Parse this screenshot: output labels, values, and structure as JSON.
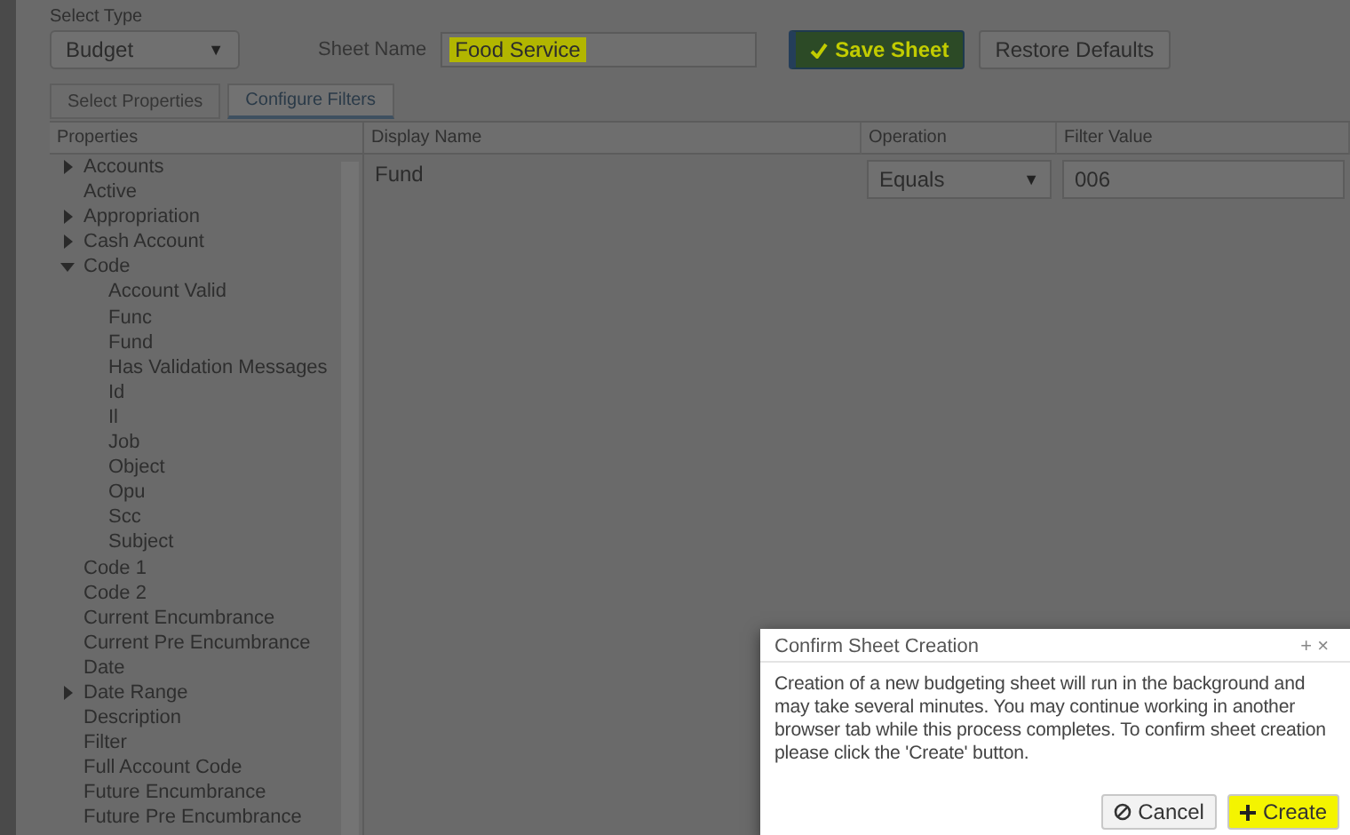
{
  "select_type": {
    "label": "Select Type",
    "value": "Budget",
    "caret": "▼"
  },
  "sheet_name": {
    "label": "Sheet Name",
    "value": "Food Service",
    "highlighted": true
  },
  "buttons": [
    {
      "kind": "save",
      "label": "Save Sheet",
      "highlighted": true
    },
    {
      "kind": "plain",
      "label": "Restore Defaults",
      "highlighted": false
    }
  ],
  "tabs": [
    {
      "label": "Select Properties",
      "selected": false
    },
    {
      "label": "Configure Filters",
      "selected": true
    }
  ],
  "properties": {
    "header": "Properties",
    "items": [
      {
        "label": "Accounts",
        "kind": "branch",
        "expanded": false
      },
      {
        "label": "Active",
        "kind": "leaf"
      },
      {
        "label": "Appropriation",
        "kind": "branch",
        "expanded": false
      },
      {
        "label": "Cash Account",
        "kind": "branch",
        "expanded": false
      },
      {
        "label": "Code",
        "kind": "branch",
        "expanded": true,
        "children": [
          {
            "label": "Account Valid",
            "kind": "leaf"
          },
          {
            "label": "Func",
            "kind": "leaf"
          },
          {
            "label": "Fund",
            "kind": "leaf"
          },
          {
            "label": "Has Validation Messages",
            "kind": "leaf"
          },
          {
            "label": "Id",
            "kind": "leaf"
          },
          {
            "label": "Il",
            "kind": "leaf"
          },
          {
            "label": "Job",
            "kind": "leaf"
          },
          {
            "label": "Object",
            "kind": "leaf"
          },
          {
            "label": "Opu",
            "kind": "leaf"
          },
          {
            "label": "Scc",
            "kind": "leaf"
          },
          {
            "label": "Subject",
            "kind": "leaf"
          }
        ]
      },
      {
        "label": "Code 1",
        "kind": "leaf"
      },
      {
        "label": "Code 2",
        "kind": "leaf"
      },
      {
        "label": "Current Encumbrance",
        "kind": "leaf"
      },
      {
        "label": "Current Pre Encumbrance",
        "kind": "leaf"
      },
      {
        "label": "Date",
        "kind": "leaf"
      },
      {
        "label": "Date Range",
        "kind": "branch",
        "expanded": false
      },
      {
        "label": "Description",
        "kind": "leaf"
      },
      {
        "label": "Filter",
        "kind": "leaf"
      },
      {
        "label": "Full Account Code",
        "kind": "leaf"
      },
      {
        "label": "Future Encumbrance",
        "kind": "leaf"
      },
      {
        "label": "Future Pre Encumbrance",
        "kind": "leaf"
      }
    ]
  },
  "filters": {
    "columns": [
      "Display Name",
      "Operation",
      "Filter Value"
    ],
    "rows": [
      {
        "display_name": "Fund",
        "operation": "Equals",
        "filter_value": "006"
      }
    ]
  },
  "dialog": {
    "title": "Confirm Sheet Creation",
    "title_controls": "+ ×",
    "message": "Creation of a new budgeting sheet will run in the background and may take several minutes. You may continue working in another browser tab while this process completes. To confirm sheet creation please click the 'Create' button.",
    "buttons": [
      {
        "kind": "cancel",
        "label": "Cancel",
        "highlighted": false
      },
      {
        "kind": "create",
        "label": "Create",
        "highlighted": true
      }
    ]
  }
}
